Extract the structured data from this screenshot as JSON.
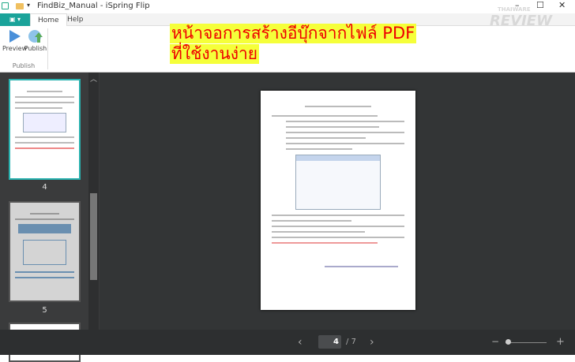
{
  "window": {
    "title": "FindBiz_Manual - iSpring Flip",
    "minimize": "–",
    "maximize": "☐",
    "close": "✕"
  },
  "ribbon": {
    "file_button": "▣ ▾",
    "tabs": [
      "Home",
      "Help"
    ],
    "buttons": [
      {
        "label": "Preview",
        "icon": "play-icon"
      },
      {
        "label": "Publish",
        "icon": "globe-upload-icon"
      }
    ],
    "group": "Publish"
  },
  "overlay": {
    "line1": "หน้าจอการสร้างอีบุ๊กจากไฟล์ PDF",
    "line2": "ที่ใช้งานง่าย"
  },
  "watermark": {
    "top": "THAIWARE",
    "main": "REVIEW"
  },
  "sidebar": {
    "thumbnails": [
      {
        "label": "4",
        "selected": true
      },
      {
        "label": "5",
        "selected": false
      }
    ]
  },
  "navigation": {
    "current_page": "4",
    "separator": "/",
    "total_pages": "7",
    "prev": "‹",
    "next": "›"
  },
  "zoom": {
    "minus": "−",
    "plus": "+",
    "level": 0.0
  }
}
